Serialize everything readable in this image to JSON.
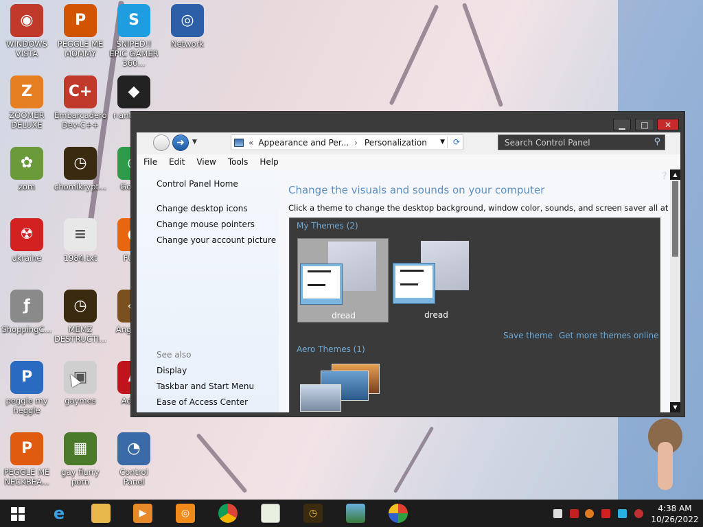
{
  "desktop_icons": [
    {
      "label": "WINDOWS VISTA",
      "icon": "vista-icon",
      "color": "#c0392b"
    },
    {
      "label": "PEGGLE ME MOMMY",
      "icon": "peggle-icon",
      "color": "#d35400"
    },
    {
      "label": "SNIPED!! EPIC GAMER 360...",
      "icon": "skype-icon",
      "color": "#1e9de0"
    },
    {
      "label": "Network",
      "icon": "network-icon",
      "color": "#2d5fa8"
    },
    {
      "label": "ZOOMER DELUXE",
      "icon": "zoomer-icon",
      "color": "#e67e22"
    },
    {
      "label": "Embarcadero Dev-C++",
      "icon": "devcpp-icon",
      "color": "#c0392b"
    },
    {
      "label": "r-anti para",
      "icon": "app-icon",
      "color": "#222222"
    },
    {
      "label": "zom",
      "icon": "flower-icon",
      "color": "#6a9a3a"
    },
    {
      "label": "chomikrypt...",
      "icon": "clock-app-icon",
      "color": "#3a2a10"
    },
    {
      "label": "Go Chr",
      "icon": "chrome-icon",
      "color": "#2e9a4a"
    },
    {
      "label": "ukraine",
      "icon": "radiation-icon",
      "color": "#d32020"
    },
    {
      "label": "1984.txt",
      "icon": "text-file-icon",
      "color": "#e8e8e8"
    },
    {
      "label": "FURR",
      "icon": "firefox-icon",
      "color": "#e8660e"
    },
    {
      "label": "ShoppingC...",
      "icon": "flash-icon",
      "color": "#8a8a8a"
    },
    {
      "label": "MEMZ DESTRUCTI...",
      "icon": "clock-app-icon",
      "color": "#3a2a10"
    },
    {
      "label": "Angr Sea",
      "icon": "game-icon",
      "color": "#7a5020"
    },
    {
      "label": "peggle my heggle",
      "icon": "peggle-icon",
      "color": "#2a6ac0"
    },
    {
      "label": "gaymes",
      "icon": "folder-icon",
      "color": "#cfcfcf"
    },
    {
      "label": "Adobe",
      "icon": "adobe-icon",
      "color": "#c0141c"
    },
    {
      "label": "PEGGLE ME NECKBEA...",
      "icon": "peggle-icon",
      "color": "#e05a10"
    },
    {
      "label": "gay fiurry porn",
      "icon": "box-icon",
      "color": "#4a7a2a"
    },
    {
      "label": "Control Panel",
      "icon": "control-panel-icon",
      "color": "#3a6aa8"
    }
  ],
  "window": {
    "controls": {
      "minimize": "▁",
      "maximize": "□",
      "close": "✕"
    },
    "breadcrumb": {
      "root_arrow": "«",
      "parent": "Appearance and Per...",
      "sep": "›",
      "current": "Personalization"
    },
    "search_placeholder": "Search Control Panel",
    "menu": [
      "File",
      "Edit",
      "View",
      "Tools",
      "Help"
    ],
    "sidebar": {
      "home": "Control Panel Home",
      "links": [
        "Change desktop icons",
        "Change mouse pointers",
        "Change your account picture"
      ],
      "see_also": "See also",
      "see_also_links": [
        "Display",
        "Taskbar and Start Menu",
        "Ease of Access Center"
      ]
    },
    "main": {
      "heading": "Change the visuals and sounds on your computer",
      "description": "Click a theme to change the desktop background, window color, sounds, and screen saver all at once.",
      "my_themes_title": "My Themes (2)",
      "themes": [
        {
          "name": "dread",
          "selected": true
        },
        {
          "name": "dread",
          "selected": false
        }
      ],
      "save_theme": "Save theme",
      "get_more": "Get more themes online",
      "aero_title": "Aero Themes (1)"
    }
  },
  "taskbar": {
    "clock_time": "4:38 AM",
    "clock_date": "10/26/2022"
  }
}
